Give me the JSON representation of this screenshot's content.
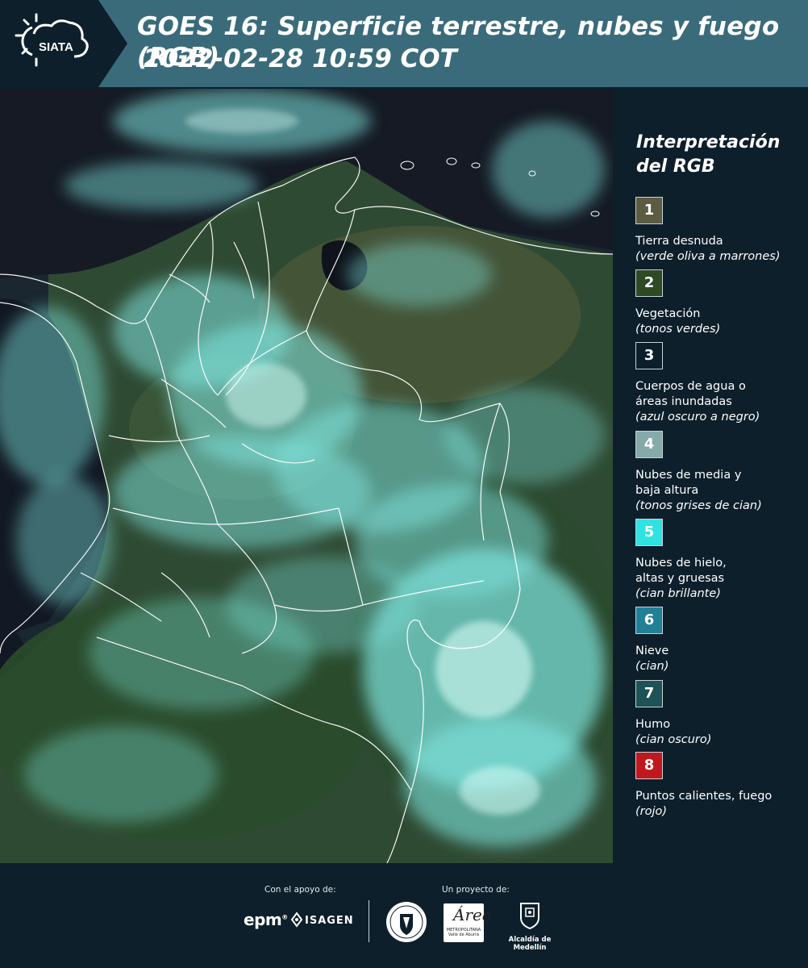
{
  "header": {
    "logo_text": "SIATA",
    "title": "GOES 16: Superficie terrestre, nubes y fuego (RGB)",
    "subtitle": "2022-02-28 10:59 COT"
  },
  "legend": {
    "title_line1": "Interpretación",
    "title_line2": "del RGB",
    "items": [
      {
        "number": "1",
        "color": "#5c5c42",
        "label": "Tierra desnuda",
        "desc": "(verde oliva a marrones)"
      },
      {
        "number": "2",
        "color": "#2e4a25",
        "label": "Vegetación",
        "desc": "(tonos verdes)"
      },
      {
        "number": "3",
        "color": "#0d1f2b",
        "label": "Cuerpos de agua o áreas inundadas",
        "desc": "(azul oscuro a negro)"
      },
      {
        "number": "4",
        "color": "#86a9aa",
        "label": "Nubes de media y baja altura",
        "desc": "(tonos grises de cian)"
      },
      {
        "number": "5",
        "color": "#2fe3e3",
        "label": "Nubes de hielo, altas y gruesas",
        "desc": "(cian brillante)"
      },
      {
        "number": "6",
        "color": "#1f8096",
        "label": "Nieve",
        "desc": "(cian)"
      },
      {
        "number": "7",
        "color": "#1d5256",
        "label": "Humo",
        "desc": "(cian oscuro)"
      },
      {
        "number": "8",
        "color": "#c0181c",
        "label": "Puntos calientes, fuego",
        "desc": "(rojo)"
      }
    ]
  },
  "footer": {
    "support_label": "Con el apoyo de:",
    "project_label": "Un proyecto de:",
    "sponsor_1": "epm",
    "sponsor_2": "ISAGEN",
    "partner_1": "Área",
    "partner_1_sub": "METROPOLITANA Valle de Aburrá",
    "partner_2": "Alcaldía de Medellín"
  }
}
